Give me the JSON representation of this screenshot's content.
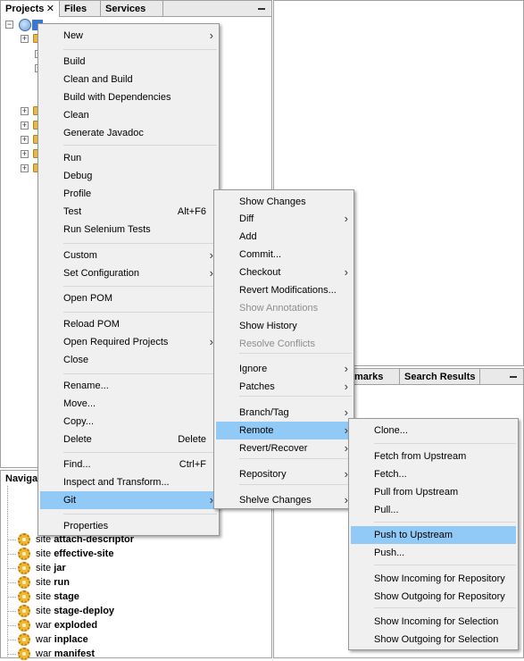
{
  "projects_panel": {
    "tabs": [
      "Projects",
      "Files",
      "Services"
    ]
  },
  "output_panel": {
    "tabs": [
      "marks",
      "Search Results"
    ]
  },
  "navigator_panel": {
    "title": "Navigat",
    "rows": [
      {
        "prefix": "site",
        "name": "attach-descriptor"
      },
      {
        "prefix": "site",
        "name": "effective-site"
      },
      {
        "prefix": "site",
        "name": "jar"
      },
      {
        "prefix": "site",
        "name": "run"
      },
      {
        "prefix": "site",
        "name": "stage"
      },
      {
        "prefix": "site",
        "name": "stage-deploy"
      },
      {
        "prefix": "war",
        "name": "exploded"
      },
      {
        "prefix": "war",
        "name": "inplace"
      },
      {
        "prefix": "war",
        "name": "manifest"
      }
    ]
  },
  "context_menu": {
    "items": [
      {
        "label": "New",
        "submenu": true
      },
      {
        "label": "Build"
      },
      {
        "label": "Clean and Build"
      },
      {
        "label": "Build with Dependencies"
      },
      {
        "label": "Clean"
      },
      {
        "label": "Generate Javadoc"
      },
      {
        "label": "Run"
      },
      {
        "label": "Debug"
      },
      {
        "label": "Profile"
      },
      {
        "label": "Test",
        "shortcut": "Alt+F6"
      },
      {
        "label": "Run Selenium Tests"
      },
      {
        "label": "Custom",
        "submenu": true
      },
      {
        "label": "Set Configuration",
        "submenu": true
      },
      {
        "label": "Open POM"
      },
      {
        "label": "Reload POM"
      },
      {
        "label": "Open Required Projects",
        "submenu": true
      },
      {
        "label": "Close"
      },
      {
        "label": "Rename..."
      },
      {
        "label": "Move..."
      },
      {
        "label": "Copy..."
      },
      {
        "label": "Delete",
        "shortcut": "Delete"
      },
      {
        "label": "Find...",
        "shortcut": "Ctrl+F"
      },
      {
        "label": "Inspect and Transform..."
      },
      {
        "label": "Git",
        "submenu": true,
        "selected": true
      },
      {
        "label": "Properties"
      }
    ]
  },
  "git_menu": {
    "items": [
      {
        "label": "Show Changes"
      },
      {
        "label": "Diff",
        "submenu": true
      },
      {
        "label": "Add"
      },
      {
        "label": "Commit..."
      },
      {
        "label": "Checkout",
        "submenu": true
      },
      {
        "label": "Revert Modifications..."
      },
      {
        "label": "Show Annotations",
        "disabled": true
      },
      {
        "label": "Show History"
      },
      {
        "label": "Resolve Conflicts",
        "disabled": true
      },
      {
        "label": "Ignore",
        "submenu": true
      },
      {
        "label": "Patches",
        "submenu": true
      },
      {
        "label": "Branch/Tag",
        "submenu": true
      },
      {
        "label": "Remote",
        "submenu": true,
        "selected": true
      },
      {
        "label": "Revert/Recover",
        "submenu": true
      },
      {
        "label": "Repository",
        "submenu": true
      },
      {
        "label": "Shelve Changes",
        "submenu": true
      }
    ]
  },
  "remote_menu": {
    "items": [
      {
        "label": "Clone..."
      },
      {
        "label": "Fetch from Upstream"
      },
      {
        "label": "Fetch..."
      },
      {
        "label": "Pull from Upstream"
      },
      {
        "label": "Pull..."
      },
      {
        "label": "Push to Upstream",
        "selected": true
      },
      {
        "label": "Push..."
      },
      {
        "label": "Show Incoming for Repository"
      },
      {
        "label": "Show Outgoing for Repository"
      },
      {
        "label": "Show Incoming for Selection"
      },
      {
        "label": "Show Outgoing for Selection"
      }
    ]
  },
  "colors": {
    "selection": "#91c9f7",
    "menu_background": "#f0f0f0",
    "disabled_text": "#8e8e8e"
  }
}
